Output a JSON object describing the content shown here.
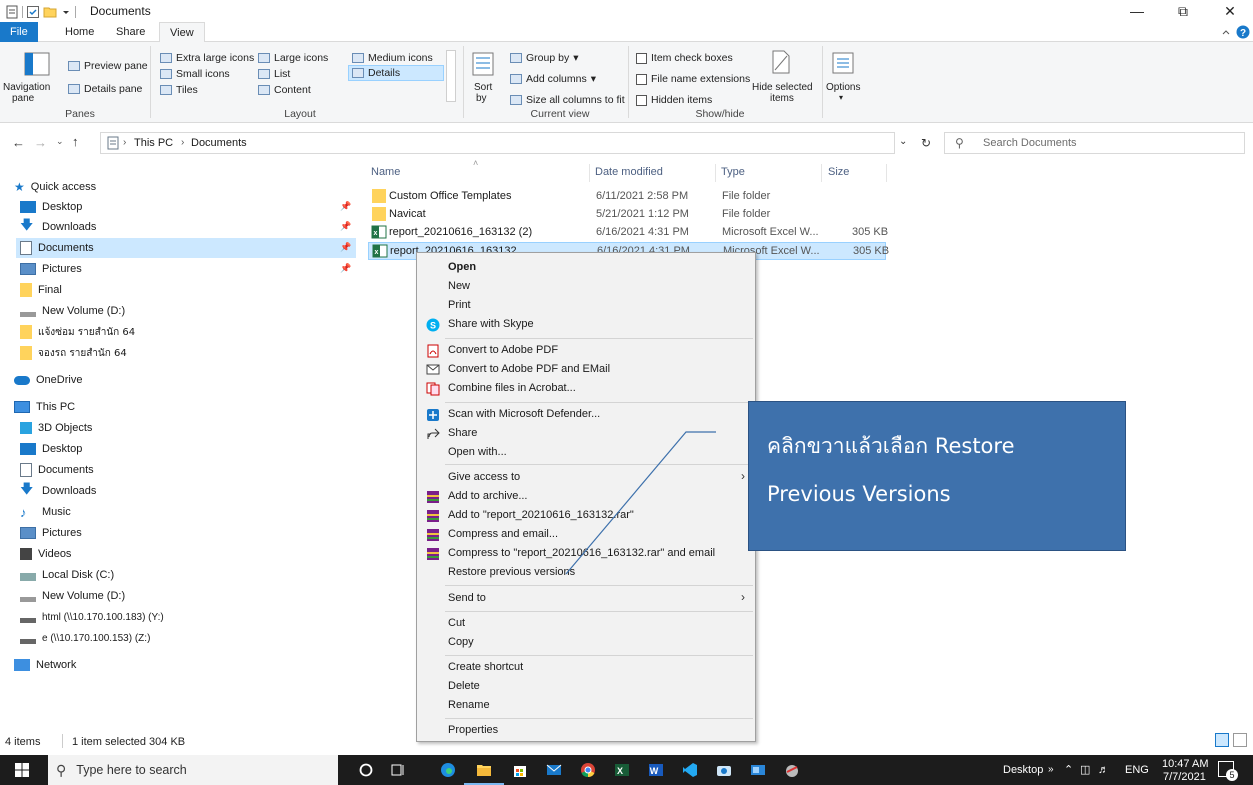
{
  "window": {
    "title": "Documents"
  },
  "ribbon": {
    "tabs": [
      "File",
      "Home",
      "Share",
      "View"
    ],
    "panes": {
      "preview_pane": "Preview pane",
      "navigation_pane": "Navigation",
      "navigation_pane_2": "pane",
      "details_pane": "Details pane",
      "label": "Panes"
    },
    "layout": {
      "extra_large": "Extra large icons",
      "large": "Large icons",
      "medium": "Medium icons",
      "small": "Small icons",
      "list": "List",
      "details": "Details",
      "tiles": "Tiles",
      "content": "Content",
      "label": "Layout"
    },
    "current_view": {
      "sort": "Sort",
      "sort_2": "by",
      "group_by": "Group by",
      "add_columns": "Add columns",
      "size_all": "Size all columns to fit",
      "label": "Current view"
    },
    "show_hide": {
      "item_check": "Item check boxes",
      "file_ext": "File name extensions",
      "hidden": "Hidden items",
      "hide_selected": "Hide selected",
      "hide_selected_2": "items",
      "label": "Show/hide"
    },
    "options": "Options"
  },
  "address": {
    "path": [
      "This PC",
      "Documents"
    ],
    "search_placeholder": "Search Documents"
  },
  "nav": {
    "quick_access": "Quick access",
    "qa_items": [
      "Desktop",
      "Downloads",
      "Documents",
      "Pictures",
      "Final",
      "New Volume (D:)",
      "แจ้งซ่อม รายสำนัก 64",
      "จองรถ รายสำนัก 64"
    ],
    "onedrive": "OneDrive",
    "this_pc": "This PC",
    "pc_items": [
      "3D Objects",
      "Desktop",
      "Documents",
      "Downloads",
      "Music",
      "Pictures",
      "Videos",
      "Local Disk (C:)",
      "New Volume (D:)",
      "html (\\\\10.170.100.183) (Y:)",
      "e (\\\\10.170.100.153) (Z:)"
    ],
    "network": "Network"
  },
  "columns": {
    "name": "Name",
    "date": "Date modified",
    "type": "Type",
    "size": "Size"
  },
  "files": [
    {
      "name": "Custom Office Templates",
      "date": "6/11/2021 2:58 PM",
      "type": "File folder",
      "size": ""
    },
    {
      "name": "Navicat",
      "date": "5/21/2021 1:12 PM",
      "type": "File folder",
      "size": ""
    },
    {
      "name": "report_20210616_163132 (2)",
      "date": "6/16/2021 4:31 PM",
      "type": "Microsoft Excel W...",
      "size": "305 KB"
    },
    {
      "name": "report_20210616_163132",
      "date": "6/16/2021 4:31 PM",
      "type": "Microsoft Excel W...",
      "size": "305 KB"
    }
  ],
  "context_menu": {
    "open": "Open",
    "new": "New",
    "print": "Print",
    "skype": "Share with Skype",
    "to_pdf": "Convert to Adobe PDF",
    "to_pdf_email": "Convert to Adobe PDF and EMail",
    "combine": "Combine files in Acrobat...",
    "defender": "Scan with Microsoft Defender...",
    "share": "Share",
    "open_with": "Open with...",
    "give_access": "Give access to",
    "add_archive": "Add to archive...",
    "add_rar": "Add to \"report_20210616_163132.rar\"",
    "compress_email": "Compress and email...",
    "compress_rar_email": "Compress to \"report_20210616_163132.rar\" and email",
    "restore": "Restore previous versions",
    "send_to": "Send to",
    "cut": "Cut",
    "copy": "Copy",
    "shortcut": "Create shortcut",
    "delete": "Delete",
    "rename": "Rename",
    "properties": "Properties"
  },
  "callout": {
    "line1": "คลิกขวาแล้วเลือก Restore",
    "line2": "Previous Versions"
  },
  "status": {
    "count": "4 items",
    "selected": "1 item selected  304 KB"
  },
  "taskbar": {
    "search_placeholder": "Type here to search",
    "desktop": "Desktop",
    "lang": "ENG",
    "time": "10:47 AM",
    "date": "7/7/2021",
    "notif": "5"
  },
  "colors": {
    "accent": "#1979ca",
    "selection": "#cce8ff",
    "callout": "#3e71ac",
    "taskbar": "#1c1c1c"
  }
}
